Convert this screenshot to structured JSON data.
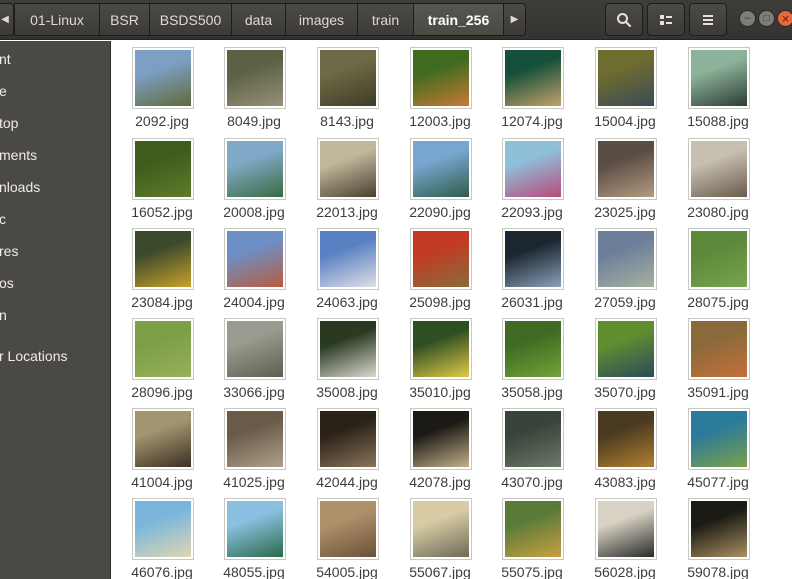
{
  "header": {
    "back_arrow": "◀",
    "forward_arrow": "▶",
    "breadcrumbs": [
      "01-Linux",
      "BSR",
      "BSDS500",
      "data",
      "images",
      "train",
      "train_256"
    ],
    "active_crumb": "train_256",
    "search_icon": "search-icon",
    "view_icon": "list-view-icon",
    "menu_icon": "hamburger-menu-icon",
    "window_buttons": {
      "minimize": "–",
      "maximize": "□",
      "close": "×"
    }
  },
  "sidebar": {
    "items": [
      "nt",
      "e",
      "top",
      "ments",
      "nloads",
      "c",
      "res",
      "os",
      "n",
      "r Locations"
    ]
  },
  "files": [
    {
      "name": "2092.jpg",
      "c1": "#7d9fc4",
      "c2": "#5e6b3a"
    },
    {
      "name": "8049.jpg",
      "c1": "#5a6145",
      "c2": "#9a8f7a"
    },
    {
      "name": "8143.jpg",
      "c1": "#6d6a45",
      "c2": "#3f3c28"
    },
    {
      "name": "12003.jpg",
      "c1": "#3e6b1f",
      "c2": "#c87a35"
    },
    {
      "name": "12074.jpg",
      "c1": "#16503a",
      "c2": "#c2a26a"
    },
    {
      "name": "15004.jpg",
      "c1": "#6e6c2e",
      "c2": "#3b4b58"
    },
    {
      "name": "15088.jpg",
      "c1": "#8cb39a",
      "c2": "#2e3c35"
    },
    {
      "name": "16052.jpg",
      "c1": "#3e5d1c",
      "c2": "#5f7b2b"
    },
    {
      "name": "20008.jpg",
      "c1": "#7fa9c7",
      "c2": "#3b6a3f"
    },
    {
      "name": "22013.jpg",
      "c1": "#c1b89c",
      "c2": "#4a3f2f"
    },
    {
      "name": "22090.jpg",
      "c1": "#78a6d0",
      "c2": "#2f5c4a"
    },
    {
      "name": "22093.jpg",
      "c1": "#8fbfd9",
      "c2": "#b84a7a"
    },
    {
      "name": "23025.jpg",
      "c1": "#5a4d46",
      "c2": "#b69a80"
    },
    {
      "name": "23080.jpg",
      "c1": "#c6bfb2",
      "c2": "#6b5a4a"
    },
    {
      "name": "23084.jpg",
      "c1": "#3c4a2c",
      "c2": "#c9a12b"
    },
    {
      "name": "24004.jpg",
      "c1": "#6d8fc6",
      "c2": "#b85c3d"
    },
    {
      "name": "24063.jpg",
      "c1": "#5a80c4",
      "c2": "#e0dfe5"
    },
    {
      "name": "25098.jpg",
      "c1": "#c23a24",
      "c2": "#8a6c3a"
    },
    {
      "name": "26031.jpg",
      "c1": "#1c2630",
      "c2": "#8aa0b8"
    },
    {
      "name": "27059.jpg",
      "c1": "#6b7f9a",
      "c2": "#a8b0a0"
    },
    {
      "name": "28075.jpg",
      "c1": "#5c8a3a",
      "c2": "#78a24e"
    },
    {
      "name": "28096.jpg",
      "c1": "#7c9e46",
      "c2": "#98b05a"
    },
    {
      "name": "33066.jpg",
      "c1": "#9a9a8e",
      "c2": "#5a6050"
    },
    {
      "name": "35008.jpg",
      "c1": "#2a3a22",
      "c2": "#d9d9d0"
    },
    {
      "name": "35010.jpg",
      "c1": "#2e4f22",
      "c2": "#e0c948"
    },
    {
      "name": "35058.jpg",
      "c1": "#3e6a22",
      "c2": "#74a23a"
    },
    {
      "name": "35070.jpg",
      "c1": "#5f8f2e",
      "c2": "#2c4a5a"
    },
    {
      "name": "35091.jpg",
      "c1": "#8a6a3a",
      "c2": "#c4703a"
    },
    {
      "name": "41004.jpg",
      "c1": "#a39570",
      "c2": "#3a2f22"
    },
    {
      "name": "41025.jpg",
      "c1": "#6a5a48",
      "c2": "#b0a08a"
    },
    {
      "name": "42044.jpg",
      "c1": "#2a2218",
      "c2": "#8a7458"
    },
    {
      "name": "42078.jpg",
      "c1": "#1c1a14",
      "c2": "#c2b08a"
    },
    {
      "name": "43070.jpg",
      "c1": "#38433a",
      "c2": "#6c7868"
    },
    {
      "name": "43083.jpg",
      "c1": "#4a3a22",
      "c2": "#b08030"
    },
    {
      "name": "45077.jpg",
      "c1": "#2a7a9a",
      "c2": "#7aa04a"
    },
    {
      "name": "46076.jpg",
      "c1": "#7ab6dc",
      "c2": "#e0d6b0"
    },
    {
      "name": "48055.jpg",
      "c1": "#8ac0e0",
      "c2": "#2a6a4a"
    },
    {
      "name": "54005.jpg",
      "c1": "#b0906a",
      "c2": "#6a5238"
    },
    {
      "name": "55067.jpg",
      "c1": "#d8cca4",
      "c2": "#6c6a58"
    },
    {
      "name": "55075.jpg",
      "c1": "#5a7a3a",
      "c2": "#c8a040"
    },
    {
      "name": "56028.jpg",
      "c1": "#d8d2c4",
      "c2": "#2a2a2a"
    },
    {
      "name": "59078.jpg",
      "c1": "#1c1a14",
      "c2": "#a89060"
    }
  ]
}
